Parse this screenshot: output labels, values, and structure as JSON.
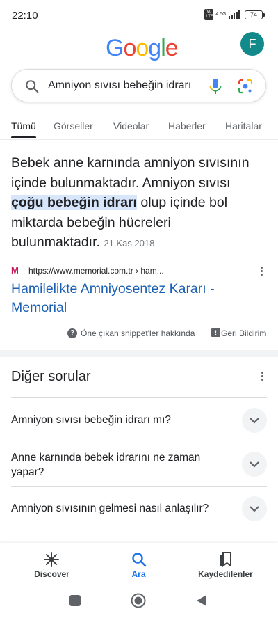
{
  "status": {
    "time": "22:10",
    "network": "4.5G",
    "volte": "Vo LTE",
    "battery": "74"
  },
  "header": {
    "avatar_letter": "F"
  },
  "search": {
    "query": "Amniyon sıvısı bebeğin idrarı"
  },
  "tabs": [
    "Tümü",
    "Görseller",
    "Videolar",
    "Haberler",
    "Haritalar"
  ],
  "snippet": {
    "text_before": "Bebek anne karnında amniyon sıvısının içinde bulunmaktadır. Amniyon sıvısı ",
    "highlight": "çoğu bebeğin idrarı",
    "text_after": " olup içinde bol miktarda bebeğin hücreleri bulunmaktadır.",
    "date": "21 Kas 2018",
    "favicon": "M",
    "source_url": "https://www.memorial.com.tr › ham...",
    "result_title": "Hamilelikte Amniyosentez Kararı - Memorial",
    "about_label": "Öne çıkan snippet'ler hakkında",
    "feedback_label": "Geri Bildirim"
  },
  "other_questions": {
    "title": "Diğer sorular",
    "items": [
      "Amniyon sıvısı bebeğin idrarı mı?",
      "Anne karnında bebek idrarını ne zaman yapar?",
      "Amniyon sıvısının gelmesi nasıl anlaşılır?"
    ]
  },
  "bottom_nav": [
    {
      "label": "Discover",
      "icon": "asterisk-icon"
    },
    {
      "label": "Ara",
      "icon": "search-icon"
    },
    {
      "label": "Kaydedilenler",
      "icon": "bookmarks-icon"
    }
  ],
  "colors": {
    "accent": "#1a73e8",
    "link": "#1a5fb4",
    "highlight": "#d7e6fb",
    "avatar": "#138a8a"
  }
}
